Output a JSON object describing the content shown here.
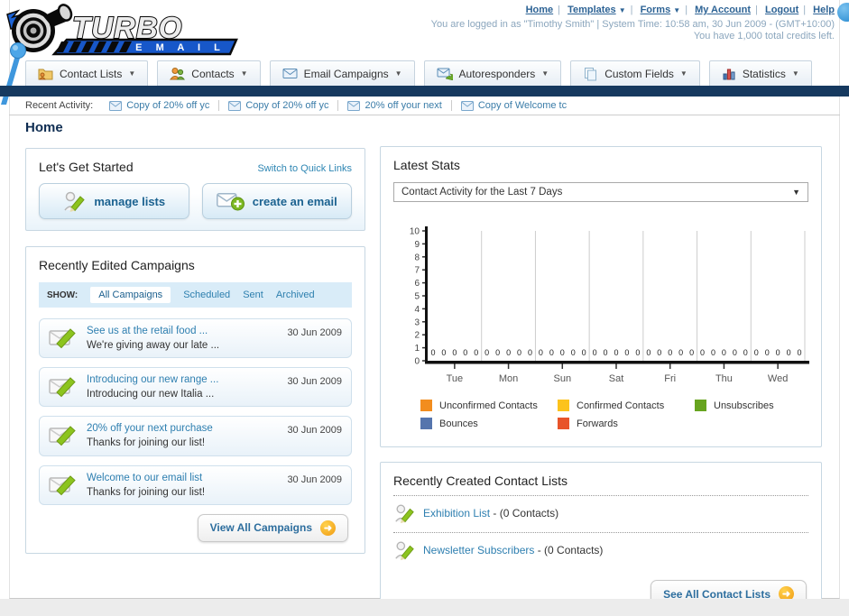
{
  "brand": {
    "name_top": "TURBO",
    "name_bottom": "E M A I L"
  },
  "header": {
    "links": [
      {
        "label": "Home",
        "dropdown": false
      },
      {
        "label": "Templates",
        "dropdown": true
      },
      {
        "label": "Forms",
        "dropdown": true
      },
      {
        "label": "My Account",
        "dropdown": false
      },
      {
        "label": "Logout",
        "dropdown": false
      },
      {
        "label": "Help",
        "dropdown": false
      }
    ],
    "login_info": "You are logged in as \"Timothy Smith\" | System Time: 10:58 am, 30 Jun 2009 - (GMT+10:00)",
    "credits": "You have 1,000 total credits left."
  },
  "nav": {
    "tabs": [
      {
        "label": "Contact Lists",
        "icon": "folder-icon"
      },
      {
        "label": "Contacts",
        "icon": "people-icon"
      },
      {
        "label": "Email Campaigns",
        "icon": "envelope-icon"
      },
      {
        "label": "Autoresponders",
        "icon": "envelope-reply-icon"
      },
      {
        "label": "Custom Fields",
        "icon": "pages-icon"
      },
      {
        "label": "Statistics",
        "icon": "bar-chart-icon"
      }
    ]
  },
  "recent_activity": {
    "label": "Recent Activity:",
    "items": [
      {
        "label": "Copy of 20% off yc"
      },
      {
        "label": "Copy of 20% off yc"
      },
      {
        "label": "20% off your next"
      },
      {
        "label": "Copy of Welcome tc"
      }
    ]
  },
  "page": {
    "title": "Home"
  },
  "get_started": {
    "title": "Let's Get Started",
    "switch_link": "Switch to Quick Links",
    "buttons": [
      {
        "label": "manage lists",
        "icon": "pencil-person-icon"
      },
      {
        "label": "create an email",
        "icon": "envelope-plus-icon"
      }
    ]
  },
  "campaigns": {
    "title": "Recently Edited Campaigns",
    "show_label": "SHOW:",
    "tabs": [
      {
        "label": "All Campaigns",
        "active": true
      },
      {
        "label": "Scheduled",
        "active": false
      },
      {
        "label": "Sent",
        "active": false
      },
      {
        "label": "Archived",
        "active": false
      }
    ],
    "items": [
      {
        "title": "See us at the retail food ...",
        "subtitle": "We're giving away our late ...",
        "date": "30 Jun 2009"
      },
      {
        "title": "Introducing our new range ...",
        "subtitle": "Introducing our new Italia ...",
        "date": "30 Jun 2009"
      },
      {
        "title": "20% off your next purchase",
        "subtitle": "Thanks for joining our list!",
        "date": "30 Jun 2009"
      },
      {
        "title": "Welcome to our email list",
        "subtitle": "Thanks for joining our list!",
        "date": "30 Jun 2009"
      }
    ],
    "view_all_label": "View All Campaigns"
  },
  "stats": {
    "title": "Latest Stats",
    "selector_value": "Contact Activity for the Last 7 Days"
  },
  "chart_data": {
    "type": "bar",
    "title": "Contact Activity for the Last 7 Days",
    "categories": [
      "Tue",
      "Mon",
      "Sun",
      "Sat",
      "Fri",
      "Thu",
      "Wed"
    ],
    "series": [
      {
        "name": "Unconfirmed Contacts",
        "color": "#f28d1e",
        "values": [
          0,
          0,
          0,
          0,
          0,
          0,
          0
        ]
      },
      {
        "name": "Confirmed Contacts",
        "color": "#fcc31c",
        "values": [
          0,
          0,
          0,
          0,
          0,
          0,
          0
        ]
      },
      {
        "name": "Unsubscribes",
        "color": "#67a41f",
        "values": [
          0,
          0,
          0,
          0,
          0,
          0,
          0
        ]
      },
      {
        "name": "Bounces",
        "color": "#5575ad",
        "values": [
          0,
          0,
          0,
          0,
          0,
          0,
          0
        ]
      },
      {
        "name": "Forwards",
        "color": "#e8542a",
        "values": [
          0,
          0,
          0,
          0,
          0,
          0,
          0
        ]
      }
    ],
    "ylim": [
      0,
      10
    ],
    "yticks": [
      0,
      1,
      2,
      3,
      4,
      5,
      6,
      7,
      8,
      9,
      10
    ],
    "grid": true,
    "legend_position": "bottom"
  },
  "contact_lists": {
    "title": "Recently Created Contact Lists",
    "items": [
      {
        "name": "Exhibition List",
        "detail": "- (0 Contacts)"
      },
      {
        "name": "Newsletter Subscribers",
        "detail": "- (0 Contacts)"
      }
    ],
    "see_all_label": "See All Contact Lists"
  }
}
